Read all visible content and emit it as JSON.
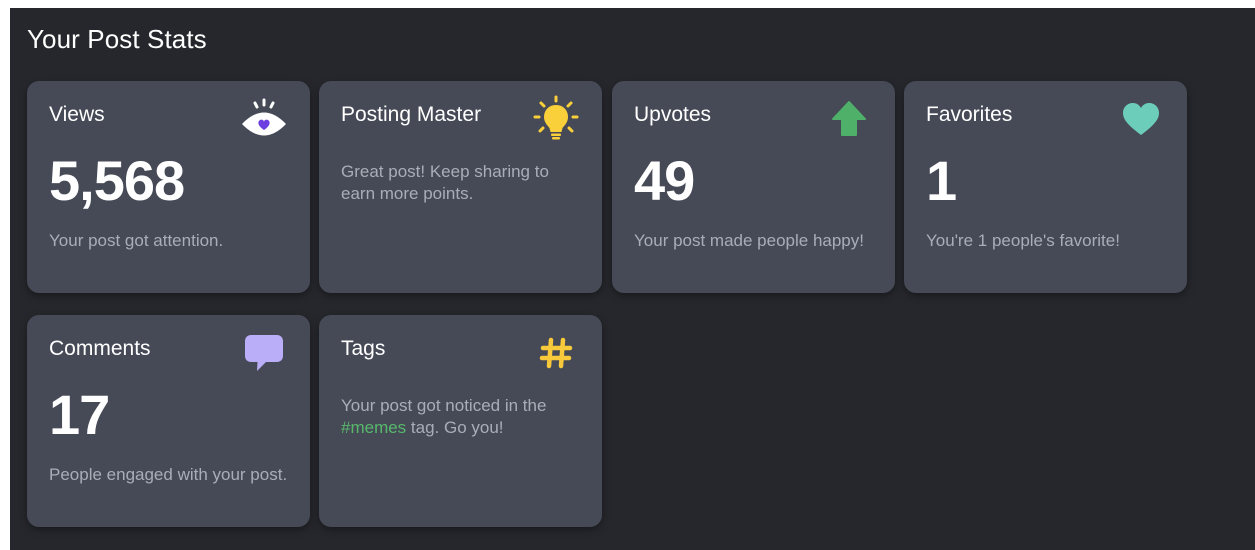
{
  "panel": {
    "title": "Your Post Stats"
  },
  "cards": {
    "views": {
      "title": "Views",
      "value": "5,568",
      "desc": "Your post got attention.",
      "icon": "eye-icon"
    },
    "posting_master": {
      "title": "Posting Master",
      "desc": "Great post! Keep sharing to earn more points.",
      "icon": "lightbulb-icon"
    },
    "upvotes": {
      "title": "Upvotes",
      "value": "49",
      "desc": "Your post made people happy!",
      "icon": "up-arrow-icon"
    },
    "favorites": {
      "title": "Favorites",
      "value": "1",
      "desc": "You're 1 people's favorite!",
      "icon": "heart-icon"
    },
    "comments": {
      "title": "Comments",
      "value": "17",
      "desc": "People engaged with your post.",
      "icon": "speech-bubble-icon"
    },
    "tags": {
      "title": "Tags",
      "desc_prefix": "Your post got noticed in the ",
      "tag": "#memes",
      "desc_suffix": " tag. Go you!",
      "icon": "hashtag-icon"
    }
  },
  "colors": {
    "background": "#26272c",
    "card": "#464a56",
    "muted_text": "#a9adb8",
    "eye_purple": "#6c3fe0",
    "bulb_yellow": "#f9cf3a",
    "upvote_green": "#4fb06a",
    "heart_teal": "#6ccdbb",
    "comment_lavender": "#b9aef7",
    "hashtag_yellow": "#f7c93b",
    "tag_green": "#57b86b"
  }
}
